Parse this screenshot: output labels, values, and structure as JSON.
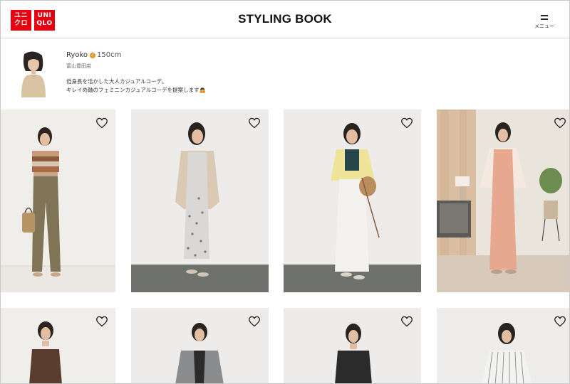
{
  "header": {
    "logo_left": "ユニ\nクロ",
    "logo_right": "UNI\nQLO",
    "title": "STYLING BOOK",
    "menu_label": "メニュー"
  },
  "profile": {
    "name": "Ryoko",
    "height": "150cm",
    "store": "富山豊田店",
    "desc_line1": "低身長を活かした大人カジュアルコーデ。",
    "desc_line2": "キレイめ軸のフェミニンカジュアルコーデを提案します🙇"
  },
  "colors": {
    "brand_red": "#e60012",
    "badge_orange": "#e39a2a"
  },
  "outfits": [
    {
      "label": "striped knit top with khaki wide pants",
      "icon": "heart-icon"
    },
    {
      "label": "beige jacket with floral dress",
      "icon": "heart-icon"
    },
    {
      "label": "yellow cardigan with white skirt",
      "icon": "heart-icon"
    },
    {
      "label": "coral jumpsuit with cardigan",
      "icon": "heart-icon"
    },
    {
      "label": "brown sleeveless top",
      "icon": "heart-icon"
    },
    {
      "label": "grey vest outfit",
      "icon": "heart-icon"
    },
    {
      "label": "black sleeveless top",
      "icon": "heart-icon"
    },
    {
      "label": "striped shirt dress",
      "icon": "heart-icon"
    }
  ]
}
